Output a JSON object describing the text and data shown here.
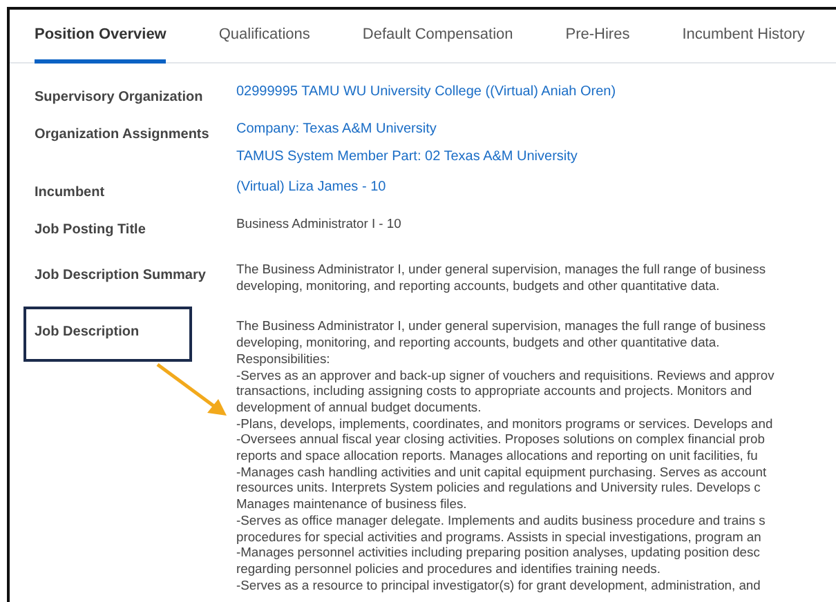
{
  "tabs": [
    {
      "label": "Position Overview",
      "selected": true
    },
    {
      "label": "Qualifications",
      "selected": false
    },
    {
      "label": "Default Compensation",
      "selected": false
    },
    {
      "label": "Pre-Hires",
      "selected": false
    },
    {
      "label": "Incumbent History",
      "selected": false
    }
  ],
  "fields": [
    {
      "label": "Supervisory Organization",
      "kind": "link",
      "values": [
        "02999995 TAMU WU University College ((Virtual) Aniah Oren)"
      ]
    },
    {
      "label": "Organization Assignments",
      "kind": "link",
      "values": [
        "Company: Texas A&M University",
        "TAMUS System Member Part: 02 Texas A&M University"
      ]
    },
    {
      "label": "Incumbent",
      "kind": "link",
      "values": [
        "(Virtual) Liza James - 10"
      ]
    },
    {
      "label": "Job Posting Title",
      "kind": "text",
      "values": [
        "Business Administrator I - 10"
      ]
    },
    {
      "label": "Job Description Summary",
      "kind": "text",
      "values": [
        "The Business Administrator I, under general supervision, manages the full range of business",
        "developing, monitoring, and reporting accounts, budgets and other quantitative data."
      ]
    },
    {
      "label": "Job Description",
      "kind": "text",
      "highlighted": true,
      "values": [
        "The Business Administrator I, under general supervision, manages the full range of business",
        "developing, monitoring, and reporting accounts, budgets and other quantitative data.",
        "Responsibilities:",
        "-Serves as an approver and back-up signer of vouchers and requisitions. Reviews and approv",
        "transactions, including assigning costs to appropriate accounts and projects. Monitors and",
        "development of annual budget documents.",
        "-Plans, develops, implements, coordinates, and monitors programs or services. Develops and",
        "-Oversees annual fiscal year closing activities. Proposes solutions on complex financial prob",
        "reports and space allocation reports. Manages allocations and reporting on unit facilities, fu",
        "-Manages cash handling activities and unit capital equipment purchasing. Serves as account",
        "resources units. Interprets System policies and regulations and University rules.  Develops c",
        "Manages maintenance of business files.",
        "-Serves as office manager delegate. Implements and audits business procedure and trains s",
        "procedures for special activities and programs. Assists in special investigations, program an",
        "-Manages personnel activities including preparing position analyses, updating position desc",
        "regarding personnel policies and procedures and identifies training needs.",
        "-Serves as a resource to principal investigator(s) for grant development, administration, and"
      ]
    }
  ]
}
